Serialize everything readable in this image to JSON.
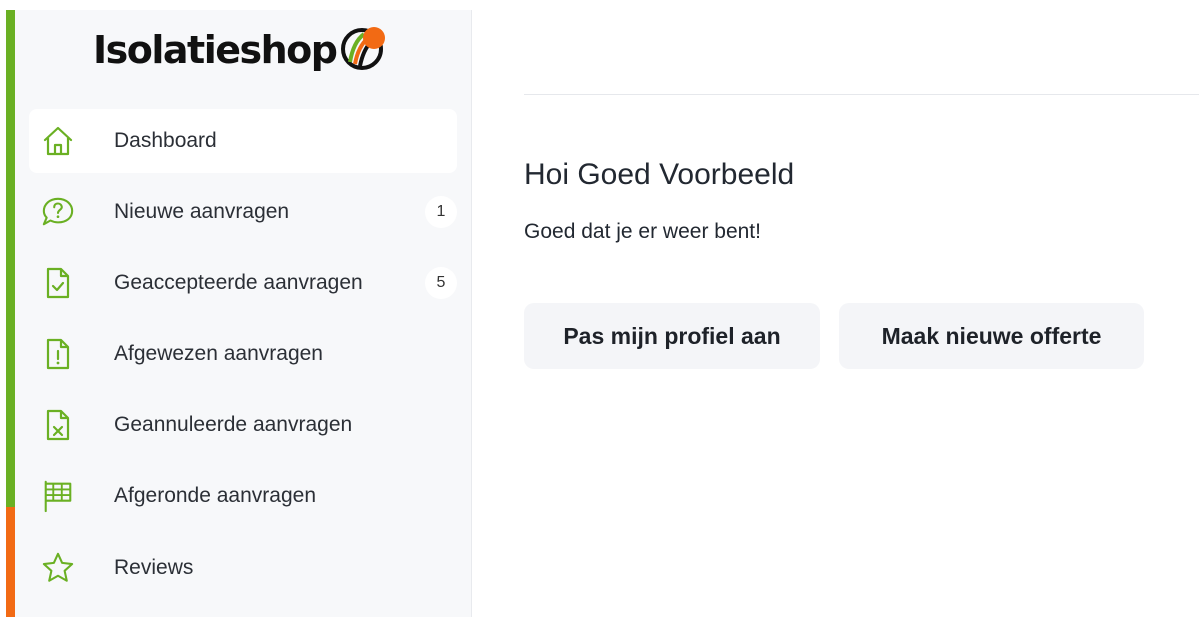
{
  "brand": {
    "name": "Isolatieshop",
    "logo_text": "Isolatieshop",
    "accent_green": "#6ab023",
    "accent_orange": "#f26a14"
  },
  "sidebar": {
    "items": [
      {
        "label": "Dashboard",
        "icon": "home-icon",
        "badge": "",
        "active": true
      },
      {
        "label": "Nieuwe aanvragen",
        "icon": "question-bubble-icon",
        "badge": "1",
        "active": false
      },
      {
        "label": "Geaccepteerde aanvragen",
        "icon": "document-check-icon",
        "badge": "5",
        "active": false
      },
      {
        "label": "Afgewezen aanvragen",
        "icon": "document-exclamation-icon",
        "badge": "",
        "active": false
      },
      {
        "label": "Geannuleerde aanvragen",
        "icon": "document-x-icon",
        "badge": "",
        "active": false
      },
      {
        "label": "Afgeronde aanvragen",
        "icon": "flag-icon",
        "badge": "",
        "active": false
      },
      {
        "label": "Reviews",
        "icon": "star-icon",
        "badge": "",
        "active": false
      }
    ]
  },
  "main": {
    "greeting": "Hoi Goed Voorbeeld",
    "subtext": "Goed dat je er weer bent!",
    "buttons": {
      "edit_profile": "Pas mijn profiel aan",
      "new_quote": "Maak nieuwe offerte"
    }
  }
}
